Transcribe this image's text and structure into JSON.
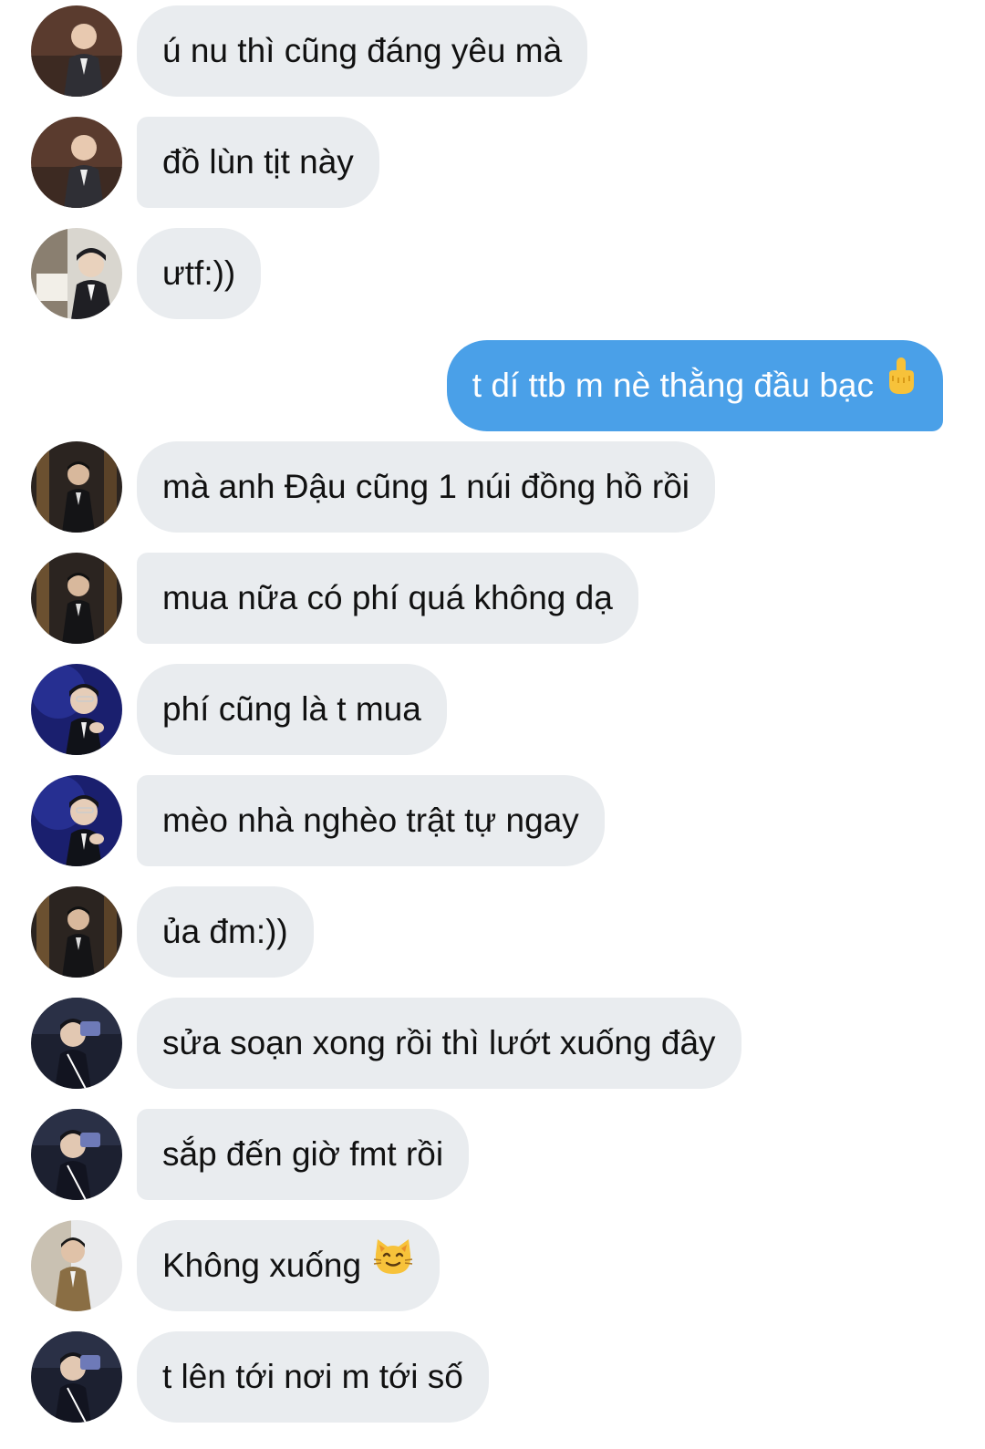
{
  "messages": [
    {
      "direction": "in",
      "avatar": "avatar-1",
      "text": "ú nu thì cũng đáng yêu mà"
    },
    {
      "direction": "in",
      "avatar": "avatar-1",
      "text": "đồ lùn tịt này"
    },
    {
      "direction": "in",
      "avatar": "avatar-2",
      "text": "ưtf:))"
    },
    {
      "direction": "out",
      "text": "t dí ttb m nè thằng đầu bạc",
      "emoji": "middle-finger-emoji"
    },
    {
      "direction": "in",
      "avatar": "avatar-3",
      "text": "mà anh Đậu cũng 1 núi đồng hồ rồi"
    },
    {
      "direction": "in",
      "avatar": "avatar-3",
      "text": "mua nữa có phí quá không dạ"
    },
    {
      "direction": "in",
      "avatar": "avatar-4",
      "text": "phí cũng là t mua"
    },
    {
      "direction": "in",
      "avatar": "avatar-4",
      "text": "mèo nhà nghèo trật tự ngay"
    },
    {
      "direction": "in",
      "avatar": "avatar-3",
      "text": "ủa đm:))"
    },
    {
      "direction": "in",
      "avatar": "avatar-5",
      "text": "sửa soạn xong rồi thì lướt xuống đây"
    },
    {
      "direction": "in",
      "avatar": "avatar-5",
      "text": "sắp đến giờ fmt rồi"
    },
    {
      "direction": "in",
      "avatar": "avatar-6",
      "text": "Không xuống",
      "emoji": "smiling-cat-emoji"
    },
    {
      "direction": "in",
      "avatar": "avatar-5",
      "text": "t lên tới nơi m tới số"
    }
  ],
  "colors": {
    "incoming_bubble": "#e9ecef",
    "outgoing_bubble": "#4aa0e8",
    "incoming_text": "#111111",
    "outgoing_text": "#ffffff"
  }
}
